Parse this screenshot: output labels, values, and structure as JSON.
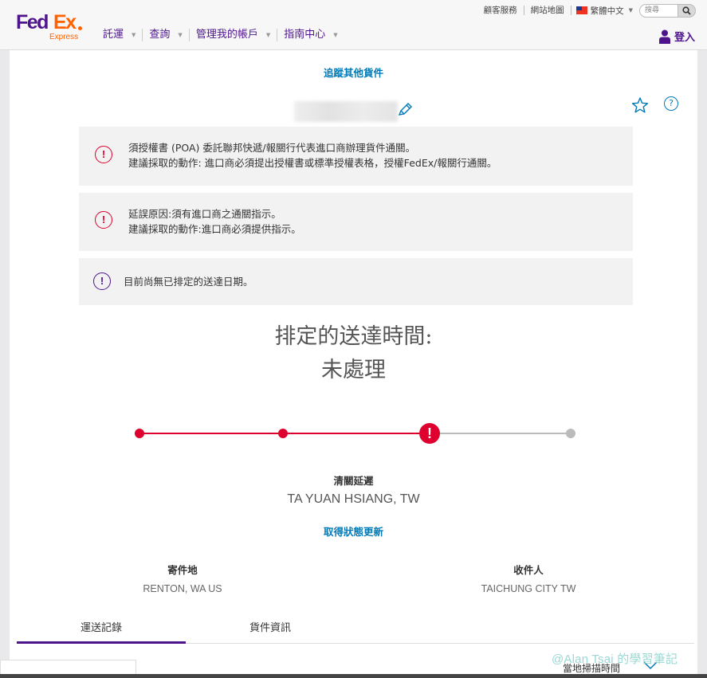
{
  "header": {
    "logo": {
      "fed": "Fed",
      "ex": "Ex",
      "sub": "Express"
    },
    "utility": {
      "customer_service": "顧客服務",
      "sitemap": "網站地圖",
      "language": "繁體中文",
      "search_placeholder": "搜尋"
    },
    "nav": [
      "託運",
      "查詢",
      "管理我的帳戶",
      "指南中心"
    ],
    "login": "登入"
  },
  "main": {
    "track_other": "追蹤其他貨件",
    "alerts": [
      {
        "line1": "須授權書 (POA) 委託聯邦快遞/報關行代表進口商辦理貨件通關。",
        "line2": "建議採取的動作: 進口商必須提出授權書或標準授權表格，授權FedEx/報關行通關。"
      },
      {
        "line1": "延誤原因:須有進口商之通關指示。",
        "line2": "建議採取的動作:進口商必須提供指示。"
      },
      {
        "line1": "目前尚無已排定的送達日期。"
      }
    ],
    "scheduled": {
      "label": "排定的送達時間:",
      "value": "未處理"
    },
    "progress": {
      "completed_steps": 3,
      "total_steps": 4,
      "exception_step": 3
    },
    "status": {
      "title": "清關延遲",
      "location": "TA YUAN HSIANG, TW",
      "update_link": "取得狀態更新"
    },
    "origin": {
      "label": "寄件地",
      "value": "RENTON, WA US"
    },
    "destination": {
      "label": "收件人",
      "value": "TAICHUNG CITY TW"
    },
    "tabs": [
      {
        "label": "運送記錄",
        "active": true
      },
      {
        "label": "貨件資訊",
        "active": false
      }
    ],
    "column_label": "當地掃描時間",
    "watermark": "@Alan Tsai 的學習筆記"
  },
  "colors": {
    "fedex_purple": "#4d148c",
    "fedex_orange": "#ff6200",
    "alert_red": "#de002e",
    "link_blue": "#007ab7"
  }
}
